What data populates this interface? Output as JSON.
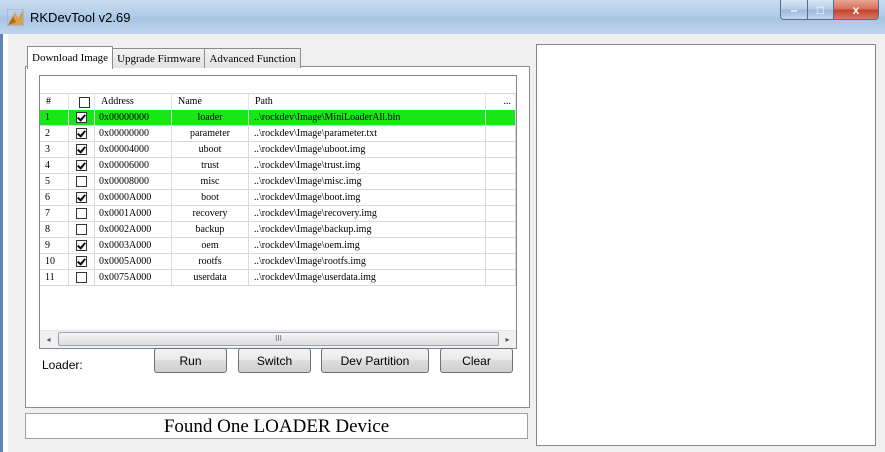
{
  "window": {
    "title": "RKDevTool v2.69",
    "min_symbol": "–",
    "max_symbol": "□",
    "close_symbol": "x"
  },
  "tabs": [
    {
      "label": "Download Image",
      "active": true
    },
    {
      "label": "Upgrade Firmware",
      "active": false
    },
    {
      "label": "Advanced Function",
      "active": false
    }
  ],
  "table": {
    "headers": {
      "num": "#",
      "address": "Address",
      "name": "Name",
      "path": "Path",
      "more": "..."
    },
    "rows": [
      {
        "num": "1",
        "checked": true,
        "address": "0x00000000",
        "name": "loader",
        "path": "..\\rockdev\\Image\\MiniLoaderAll.bin",
        "selected": true
      },
      {
        "num": "2",
        "checked": true,
        "address": "0x00000000",
        "name": "parameter",
        "path": "..\\rockdev\\Image\\parameter.txt",
        "selected": false
      },
      {
        "num": "3",
        "checked": true,
        "address": "0x00004000",
        "name": "uboot",
        "path": "..\\rockdev\\Image\\uboot.img",
        "selected": false
      },
      {
        "num": "4",
        "checked": true,
        "address": "0x00006000",
        "name": "trust",
        "path": "..\\rockdev\\Image\\trust.img",
        "selected": false
      },
      {
        "num": "5",
        "checked": false,
        "address": "0x00008000",
        "name": "misc",
        "path": "..\\rockdev\\Image\\misc.img",
        "selected": false
      },
      {
        "num": "6",
        "checked": true,
        "address": "0x0000A000",
        "name": "boot",
        "path": "..\\rockdev\\Image\\boot.img",
        "selected": false
      },
      {
        "num": "7",
        "checked": false,
        "address": "0x0001A000",
        "name": "recovery",
        "path": "..\\rockdev\\Image\\recovery.img",
        "selected": false
      },
      {
        "num": "8",
        "checked": false,
        "address": "0x0002A000",
        "name": "backup",
        "path": "..\\rockdev\\Image\\backup.img",
        "selected": false
      },
      {
        "num": "9",
        "checked": true,
        "address": "0x0003A000",
        "name": "oem",
        "path": "..\\rockdev\\Image\\oem.img",
        "selected": false
      },
      {
        "num": "10",
        "checked": true,
        "address": "0x0005A000",
        "name": "rootfs",
        "path": "..\\rockdev\\Image\\rootfs.img",
        "selected": false
      },
      {
        "num": "11",
        "checked": false,
        "address": "0x0075A000",
        "name": "userdata",
        "path": "..\\rockdev\\Image\\userdata.img",
        "selected": false
      }
    ],
    "scroll_left": "◂",
    "scroll_right": "▸",
    "scroll_grip": "III"
  },
  "controls": {
    "loader_label": "Loader:",
    "run": "Run",
    "switch": "Switch",
    "dev_partition": "Dev Partition",
    "clear": "Clear"
  },
  "status": "Found One LOADER Device",
  "colors": {
    "selected_row": "#19e619"
  }
}
